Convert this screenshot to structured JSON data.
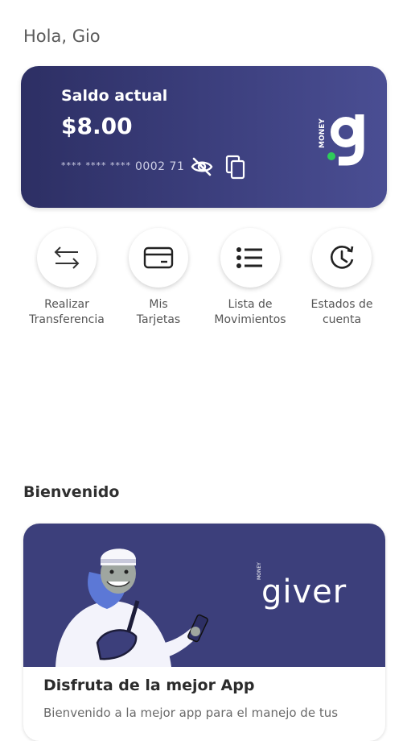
{
  "header": {
    "greeting": "Hola, Gio"
  },
  "balance": {
    "label": "Saldo actual",
    "amount": "$8.00",
    "card_mask": "**** **** ****",
    "card_suffix": "0002 71",
    "logo_text": "MONEY",
    "icons": [
      "eye-off-icon",
      "copy-icon"
    ]
  },
  "actions": [
    {
      "line1": "Realizar",
      "line2": "Transferencia",
      "icon": "transfer-arrows-icon"
    },
    {
      "line1": "Mis",
      "line2": "Tarjetas",
      "icon": "credit-card-icon"
    },
    {
      "line1": "Lista de",
      "line2": "Movimientos",
      "icon": "list-icon"
    },
    {
      "line1": "Estados de",
      "line2": "cuenta",
      "icon": "clock-icon"
    }
  ],
  "welcome": {
    "title": "Bienvenido",
    "brand_small": "MONEY",
    "brand_word": "giver",
    "card_title": "Disfruta de la mejor App",
    "card_text": "Bienvenido a la mejor app para el manejo de tus"
  },
  "colors": {
    "card_dark": "#2d2f64",
    "card_light": "#4a4e93",
    "banner": "#3c3f7b",
    "accent_green": "#2ecc5a"
  }
}
